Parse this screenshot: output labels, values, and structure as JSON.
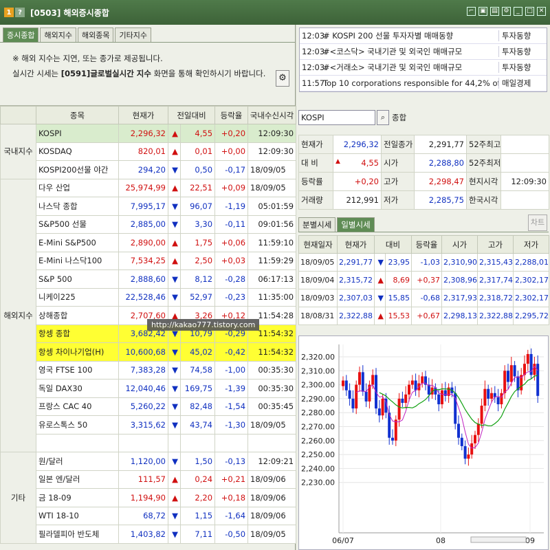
{
  "window": {
    "badge1": "1",
    "badge2": "?",
    "title": "[0503] 해외증시종합"
  },
  "tabs": [
    "증시종합",
    "해외지수",
    "해외종목",
    "기타지수"
  ],
  "notice": {
    "line1": "※ 해외 지수는 지연, 또는 종가로 제공됩니다.",
    "line2_prefix": "실시간 시세는",
    "line2_code": "[0591]글로벌실시간 지수",
    "line2_suffix": "화면을 통해 확인하시기 바랍니다."
  },
  "table": {
    "headers": [
      "종목",
      "현재가",
      "전일대비",
      "등락율",
      "국내수신시각"
    ],
    "categories": [
      {
        "label": "국내지수",
        "rows": 3
      },
      {
        "label": "해외지수",
        "rows": 15
      },
      {
        "label": "기타",
        "rows": 5
      }
    ],
    "rows": [
      {
        "name": "KOSPI",
        "price": "2,296,32",
        "dir": "up",
        "change": "4,55",
        "rate": "+0,20",
        "date": "",
        "time": "12:09:30",
        "sel": true
      },
      {
        "name": "KOSDAQ",
        "price": "820,01",
        "dir": "up",
        "change": "0,01",
        "rate": "+0,00",
        "date": "",
        "time": "12:09:30"
      },
      {
        "name": "KOSPI200선물 야간",
        "price": "294,20",
        "dir": "down",
        "change": "0,50",
        "rate": "-0,17",
        "date": "18/09/05",
        "time": ""
      },
      {
        "name": "다우 산업",
        "price": "25,974,99",
        "dir": "up",
        "change": "22,51",
        "rate": "+0,09",
        "date": "18/09/05",
        "time": ""
      },
      {
        "name": "나스닥 종합",
        "price": "7,995,17",
        "dir": "down",
        "change": "96,07",
        "rate": "-1,19",
        "date": "18/09/06",
        "time": "05:01:59"
      },
      {
        "name": "S&P500 선물",
        "price": "2,885,00",
        "dir": "down",
        "change": "3,30",
        "rate": "-0,11",
        "date": "18/09/06",
        "time": "09:01:56"
      },
      {
        "name": "E-Mini S&P500",
        "price": "2,890,00",
        "dir": "up",
        "change": "1,75",
        "rate": "+0,06",
        "date": "18/09/06",
        "time": "11:59:10"
      },
      {
        "name": "E-Mini 나스닥100",
        "price": "7,534,25",
        "dir": "up",
        "change": "2,50",
        "rate": "+0,03",
        "date": "18/09/06",
        "time": "11:59:29"
      },
      {
        "name": "S&P 500",
        "price": "2,888,60",
        "dir": "down",
        "change": "8,12",
        "rate": "-0,28",
        "date": "18/09/06",
        "time": "06:17:13"
      },
      {
        "name": "니케이225",
        "price": "22,528,46",
        "dir": "down",
        "change": "52,97",
        "rate": "-0,23",
        "date": "18/09/06",
        "time": "11:35:00"
      },
      {
        "name": "상해종합",
        "price": "2,707,60",
        "dir": "up",
        "change": "3,26",
        "rate": "+0,12",
        "date": "18/09/06",
        "time": "11:54:28"
      },
      {
        "name": "항셍 종합",
        "price": "3,682,42",
        "dir": "down",
        "change": "10,79",
        "rate": "-0,29",
        "date": "18/09/06",
        "time": "11:54:32",
        "hl": true
      },
      {
        "name": "항셍 차이나기업(H)",
        "price": "10,600,68",
        "dir": "down",
        "change": "45,02",
        "rate": "-0,42",
        "date": "18/09/06",
        "time": "11:54:32",
        "hl": true
      },
      {
        "name": "영국 FTSE 100",
        "price": "7,383,28",
        "dir": "down",
        "change": "74,58",
        "rate": "-1,00",
        "date": "18/09/06",
        "time": "00:35:30"
      },
      {
        "name": "독일 DAX30",
        "price": "12,040,46",
        "dir": "down",
        "change": "169,75",
        "rate": "-1,39",
        "date": "18/09/06",
        "time": "00:35:30"
      },
      {
        "name": "프랑스 CAC 40",
        "price": "5,260,22",
        "dir": "down",
        "change": "82,48",
        "rate": "-1,54",
        "date": "18/09/06",
        "time": "00:35:45"
      },
      {
        "name": "유로스톡스 50",
        "price": "3,315,62",
        "dir": "down",
        "change": "43,74",
        "rate": "-1,30",
        "date": "18/09/05",
        "time": ""
      },
      {
        "name": "",
        "price": "",
        "dir": "none",
        "change": "",
        "rate": "",
        "date": "",
        "time": ""
      },
      {
        "name": "원/달러",
        "price": "1,120,00",
        "dir": "down",
        "change": "1,50",
        "rate": "-0,13",
        "date": "18/09/06",
        "time": "12:09:21"
      },
      {
        "name": "일본 엔/달러",
        "price": "111,57",
        "dir": "up",
        "change": "0,24",
        "rate": "+0,21",
        "date": "18/09/06",
        "time": ""
      },
      {
        "name": "금 18-09",
        "price": "1,194,90",
        "dir": "up",
        "change": "2,20",
        "rate": "+0,18",
        "date": "18/09/06",
        "time": ""
      },
      {
        "name": "WTI 18-10",
        "price": "68,72",
        "dir": "down",
        "change": "1,15",
        "rate": "-1,64",
        "date": "18/09/06",
        "time": ""
      },
      {
        "name": "필라델피아 반도체",
        "price": "1,403,82",
        "dir": "down",
        "change": "7,11",
        "rate": "-0,50",
        "date": "18/09/05",
        "time": ""
      }
    ]
  },
  "watermark": "http://kakao777.tistory.com",
  "news": [
    {
      "time": "12:03:",
      "text": "# KOSPI 200 선물 투자자별 매매동향",
      "source": "투자동향"
    },
    {
      "time": "12:03:",
      "text": "#<코스닥> 국내기관 및 외국인 매매규모",
      "source": "투자동향"
    },
    {
      "time": "12:03:",
      "text": "#<거래소> 국내기관 및 외국인 매매규모",
      "source": "투자동향"
    },
    {
      "time": "11:57:",
      "text": "Top 10 corporations responsible for 44,2% of S, Kor",
      "source": "매일경제"
    }
  ],
  "search": {
    "value": "KOSPI",
    "label": "종합"
  },
  "quote": [
    [
      "현재가",
      "2,296,32",
      "전일종가",
      "2,291,77",
      "52주최고",
      ""
    ],
    [
      "대 비",
      "4,55",
      "시가",
      "2,288,80",
      "52주최저",
      ""
    ],
    [
      "등락률",
      "+0,20",
      "고가",
      "2,298,47",
      "현지시각",
      "12:09:30"
    ],
    [
      "거래량",
      "212,991",
      "저가",
      "2,285,75",
      "한국시각",
      ""
    ]
  ],
  "subtabs": [
    "분별시세",
    "일별시세"
  ],
  "chart_button": "차트",
  "daily": {
    "headers": [
      "현재일자",
      "현재가",
      "대비",
      "등락율",
      "시가",
      "고가",
      "저가"
    ],
    "rows": [
      {
        "date": "18/09/05",
        "price": "2,291,77",
        "dir": "down",
        "change": "23,95",
        "rate": "-1,03",
        "open": "2,310,90",
        "high": "2,315,43",
        "low": "2,288,01"
      },
      {
        "date": "18/09/04",
        "price": "2,315,72",
        "dir": "up",
        "change": "8,69",
        "rate": "+0,37",
        "open": "2,308,96",
        "high": "2,317,74",
        "low": "2,302,17"
      },
      {
        "date": "18/09/03",
        "price": "2,307,03",
        "dir": "down",
        "change": "15,85",
        "rate": "-0,68",
        "open": "2,317,93",
        "high": "2,318,72",
        "low": "2,302,17"
      },
      {
        "date": "18/08/31",
        "price": "2,322,88",
        "dir": "up",
        "change": "15,53",
        "rate": "+0,67",
        "open": "2,298,13",
        "high": "2,322,88",
        "low": "2,295,72"
      }
    ]
  },
  "chart": {
    "y_ticks": [
      "2,320.00",
      "2,310.00",
      "2,300.00",
      "2,290.00",
      "2,280.00",
      "2,270.00",
      "2,260.00",
      "2,250.00",
      "2,240.00",
      "2,230.00"
    ],
    "x_ticks": [
      "06/07",
      "08",
      "09"
    ],
    "colors": {
      "up": "#e81010",
      "down": "#1030d0",
      "ma1": "#c020c0",
      "ma2": "#10a010"
    }
  }
}
